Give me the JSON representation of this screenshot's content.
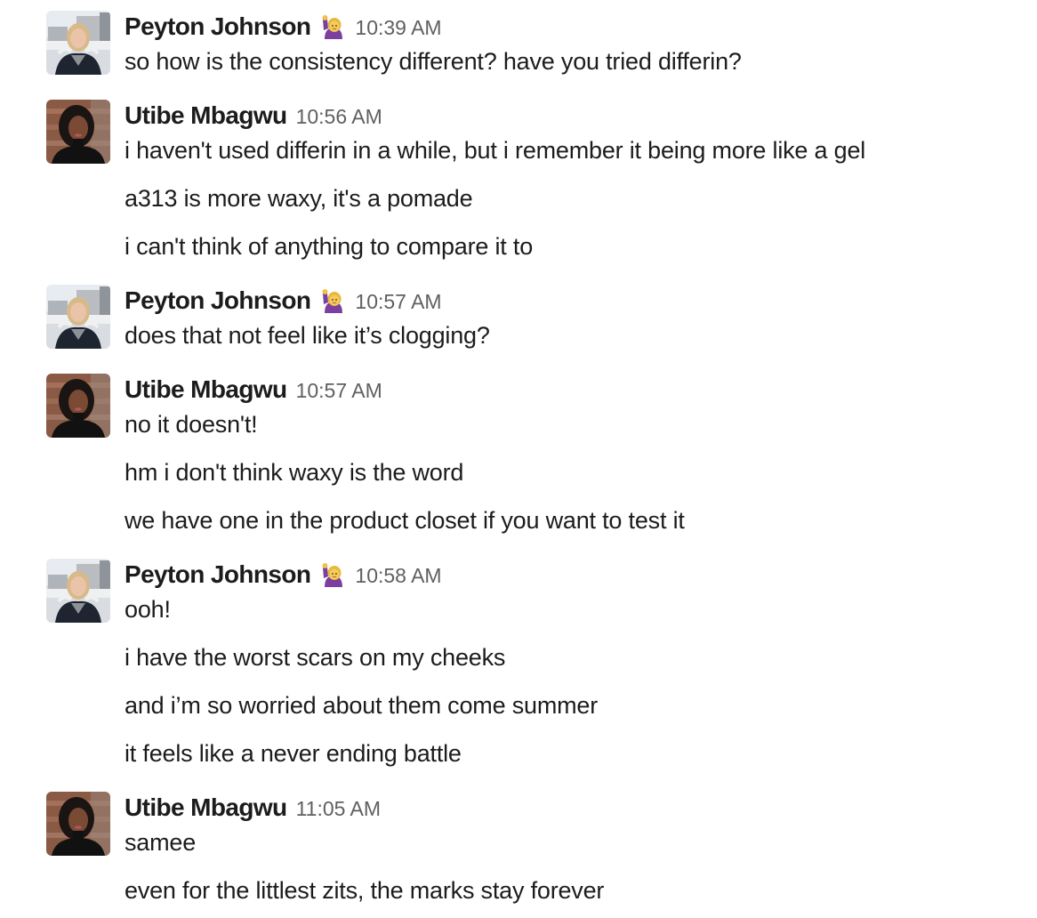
{
  "users": {
    "peyton": {
      "name": "Peyton Johnson",
      "status_emoji": "raising-hand-emoji"
    },
    "utibe": {
      "name": "Utibe Mbagwu"
    }
  },
  "groups": [
    {
      "author": "Peyton Johnson",
      "time": "10:39 AM",
      "messages": [
        "so how is the consistency different? have you tried differin?"
      ]
    },
    {
      "author": "Utibe Mbagwu",
      "time": "10:56 AM",
      "messages": [
        "i haven't used differin in a while, but i remember it being more like a gel",
        "a313 is more waxy, it's a pomade",
        "i can't think of anything to compare it to"
      ]
    },
    {
      "author": "Peyton Johnson",
      "time": "10:57 AM",
      "messages": [
        "does that not feel like it’s clogging?"
      ]
    },
    {
      "author": "Utibe Mbagwu",
      "time": "10:57 AM",
      "messages": [
        "no it doesn't!",
        "hm i don't think waxy is the word",
        "we have one in the product closet if you want to test it"
      ]
    },
    {
      "author": "Peyton Johnson",
      "time": "10:58 AM",
      "messages": [
        "ooh!",
        "i have the worst scars on my cheeks",
        "and i’m so worried about them come summer",
        "it feels like a never ending battle"
      ]
    },
    {
      "author": "Utibe Mbagwu",
      "time": "11:05 AM",
      "messages": [
        "samee",
        "even for the littlest zits, the marks stay forever"
      ]
    }
  ],
  "colors": {
    "text": "#1d1c1d",
    "timestamp": "#616061",
    "background": "#ffffff"
  }
}
